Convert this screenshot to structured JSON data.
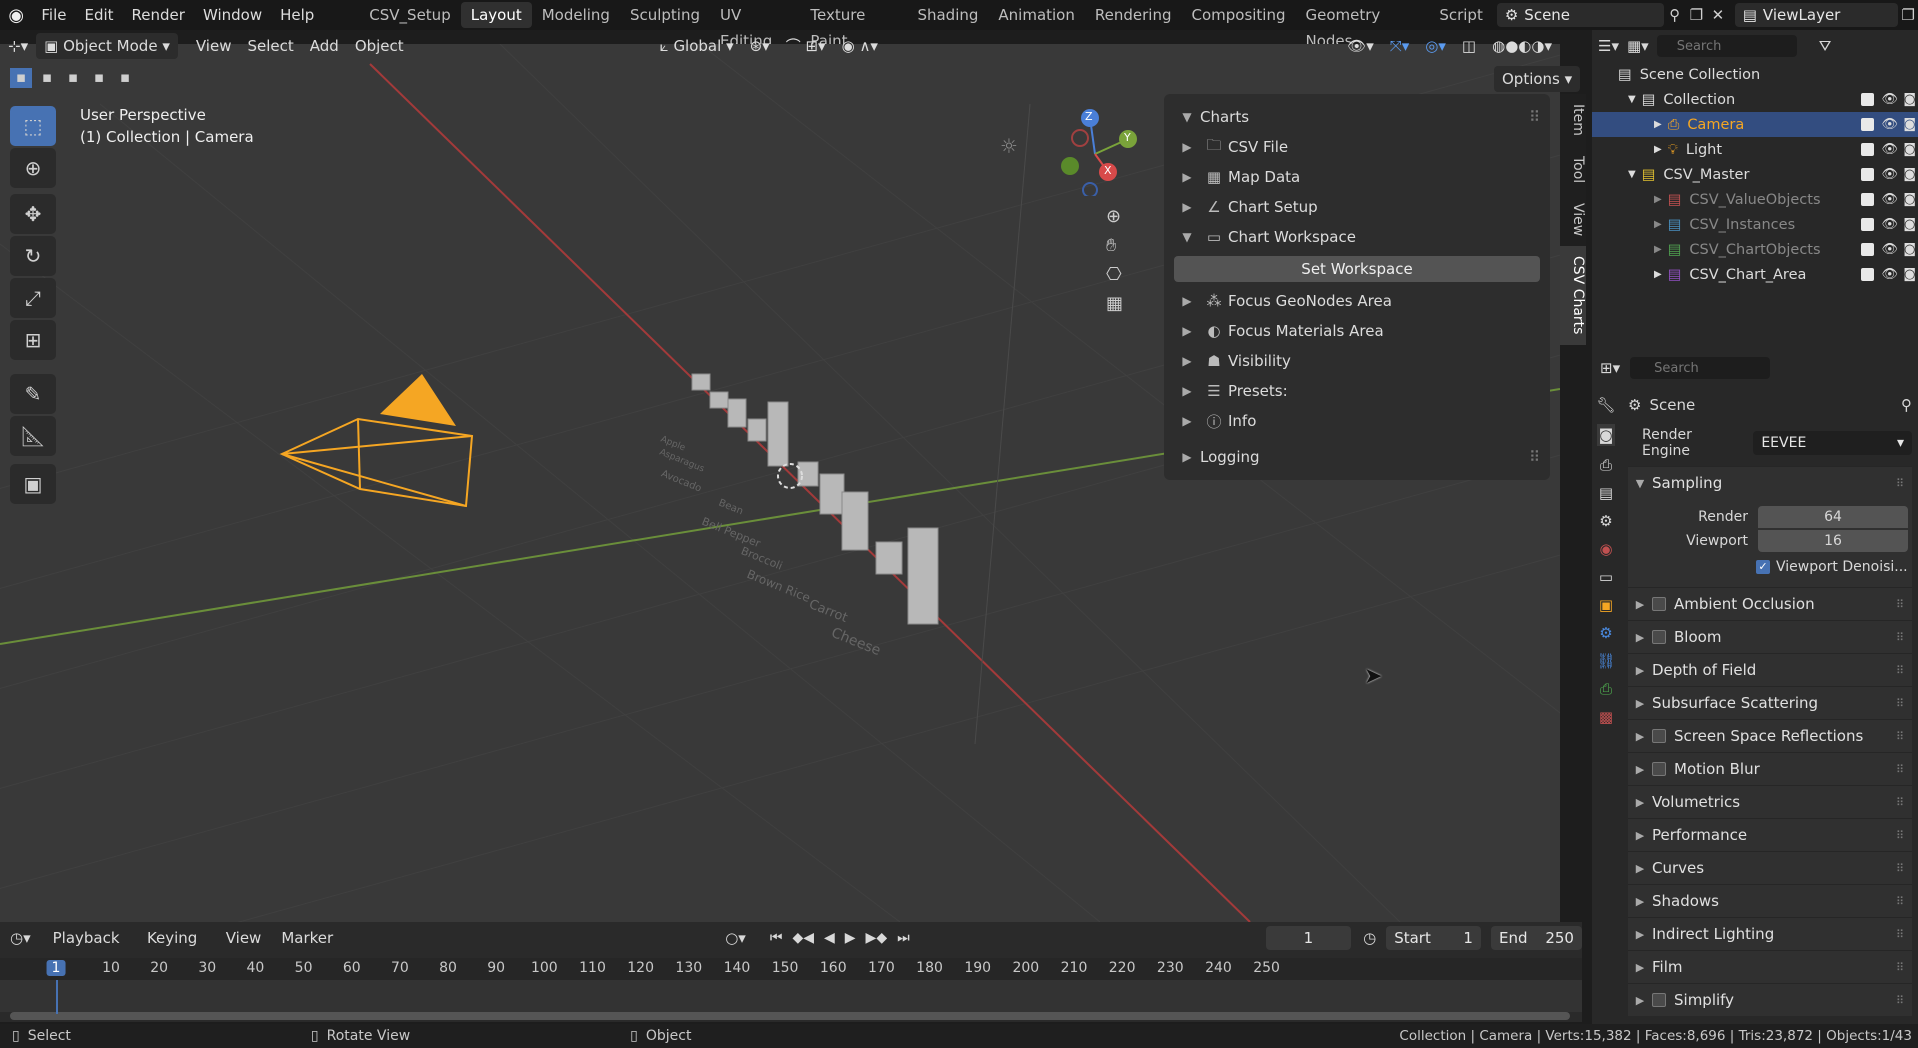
{
  "topbar": {
    "menus": [
      "File",
      "Edit",
      "Render",
      "Window",
      "Help"
    ],
    "workspaces": [
      "CSV_Setup",
      "Layout",
      "Modeling",
      "Sculpting",
      "UV Editing",
      "Texture Paint",
      "Shading",
      "Animation",
      "Rendering",
      "Compositing",
      "Geometry Nodes",
      "Script"
    ],
    "active_workspace": "Layout",
    "scene": "Scene",
    "view_layer": "ViewLayer"
  },
  "viewport_header": {
    "mode": "Object Mode",
    "menus": [
      "View",
      "Select",
      "Add",
      "Object"
    ],
    "transform": "Global",
    "options": "Options"
  },
  "viewport": {
    "perspective": "User Perspective",
    "context": "(1) Collection | Camera",
    "gizmo": {
      "z": "Z",
      "y": "Y",
      "x": "X"
    },
    "chart_labels": [
      "Cheese",
      "Carrot",
      "Brown Rice",
      "Broccoli",
      "Bell Pepper",
      "Bean",
      "Avocado",
      "Asparagus",
      "Apple"
    ]
  },
  "npanel": {
    "title": "Charts",
    "items": [
      {
        "label": "CSV File",
        "icon": "folder-icon"
      },
      {
        "label": "Map Data",
        "icon": "grid-icon"
      },
      {
        "label": "Chart Setup",
        "icon": "chart-icon"
      },
      {
        "label": "Chart Workspace",
        "icon": "workspace-icon"
      }
    ],
    "set_workspace": "Set Workspace",
    "sub_items": [
      {
        "label": "Focus GeoNodes Area",
        "icon": "nodes-icon"
      },
      {
        "label": "Focus Materials Area",
        "icon": "material-icon"
      },
      {
        "label": "Visibility",
        "icon": "ghost-icon"
      },
      {
        "label": "Presets:",
        "icon": "list-icon"
      },
      {
        "label": "Info",
        "icon": "info-icon"
      }
    ],
    "logging": "Logging",
    "tabs": [
      "Item",
      "Tool",
      "View",
      "CSV Charts"
    ]
  },
  "outliner": {
    "search_placeholder": "Search",
    "root": "Scene Collection",
    "rows": [
      {
        "label": "Collection",
        "indent": 1
      },
      {
        "label": "Camera",
        "indent": 2
      },
      {
        "label": "Light",
        "indent": 2
      },
      {
        "label": "CSV_Master",
        "indent": 1
      },
      {
        "label": "CSV_ValueObjects",
        "indent": 2
      },
      {
        "label": "CSV_Instances",
        "indent": 2
      },
      {
        "label": "CSV_ChartObjects",
        "indent": 2
      },
      {
        "label": "CSV_Chart_Area",
        "indent": 2
      }
    ]
  },
  "properties": {
    "search_placeholder": "Search",
    "context": "Scene",
    "render_engine_label": "Render Engine",
    "render_engine": "EEVEE",
    "sampling": "Sampling",
    "render_label": "Render",
    "render_value": "64",
    "viewport_label": "Viewport",
    "viewport_value": "16",
    "viewport_denoise": "Viewport Denoisi...",
    "sections": [
      {
        "label": "Ambient Occlusion",
        "checkbox": true
      },
      {
        "label": "Bloom",
        "checkbox": true
      },
      {
        "label": "Depth of Field",
        "checkbox": false
      },
      {
        "label": "Subsurface Scattering",
        "checkbox": false
      },
      {
        "label": "Screen Space Reflections",
        "checkbox": true
      },
      {
        "label": "Motion Blur",
        "checkbox": true
      },
      {
        "label": "Volumetrics",
        "checkbox": false
      },
      {
        "label": "Performance",
        "checkbox": false
      },
      {
        "label": "Curves",
        "checkbox": false
      },
      {
        "label": "Shadows",
        "checkbox": false
      },
      {
        "label": "Indirect Lighting",
        "checkbox": false
      },
      {
        "label": "Film",
        "checkbox": false
      },
      {
        "label": "Simplify",
        "checkbox": true
      }
    ]
  },
  "timeline": {
    "menus": [
      "Playback",
      "Keying",
      "View",
      "Marker"
    ],
    "current_frame": "1",
    "start_label": "Start",
    "start": "1",
    "end_label": "End",
    "end": "250",
    "ticks": [
      "1",
      "10",
      "20",
      "30",
      "40",
      "50",
      "60",
      "70",
      "80",
      "90",
      "100",
      "110",
      "120",
      "130",
      "140",
      "150",
      "160",
      "170",
      "180",
      "190",
      "200",
      "210",
      "220",
      "230",
      "240",
      "250"
    ]
  },
  "statusbar": {
    "left": [
      "Select",
      "Rotate View",
      "Object"
    ],
    "right": "Collection | Camera | Verts:15,382 | Faces:8,696 | Tris:23,872 | Objects:1/43"
  }
}
